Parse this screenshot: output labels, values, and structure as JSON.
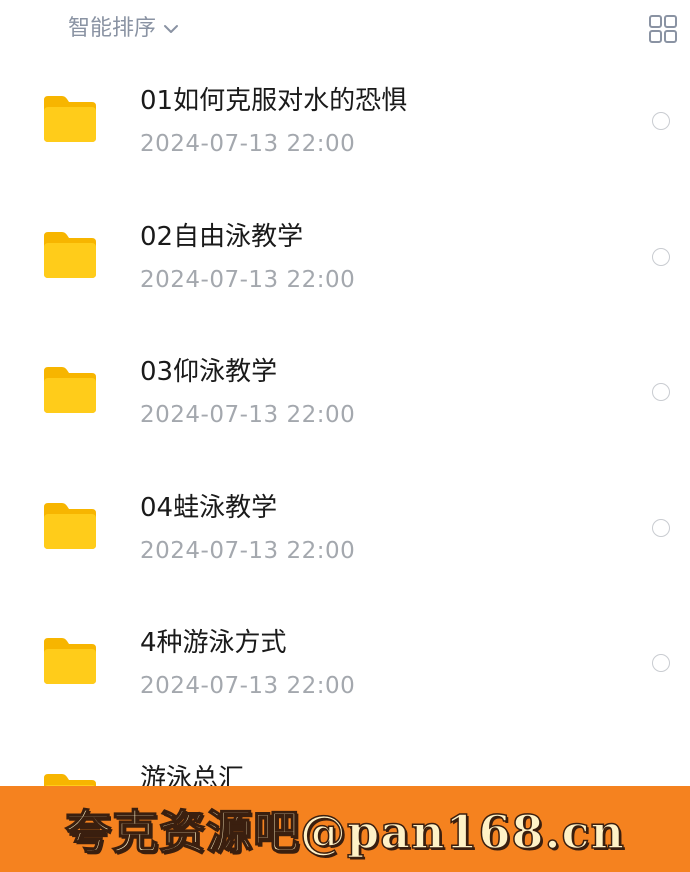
{
  "topbar": {
    "sort_label": "智能排序",
    "sort_icon": "chevron-down-icon",
    "view_toggle_icon": "grid-view-icon"
  },
  "files": [
    {
      "name": "01如何克服对水的恐惧",
      "date": "2024-07-13  22:00",
      "icon": "folder-icon"
    },
    {
      "name": "02自由泳教学",
      "date": "2024-07-13  22:00",
      "icon": "folder-icon"
    },
    {
      "name": "03仰泳教学",
      "date": "2024-07-13  22:00",
      "icon": "folder-icon"
    },
    {
      "name": "04蛙泳教学",
      "date": "2024-07-13  22:00",
      "icon": "folder-icon"
    },
    {
      "name": "4种游泳方式",
      "date": "2024-07-13  22:00",
      "icon": "folder-icon"
    },
    {
      "name": "游泳总汇",
      "date": "",
      "icon": "folder-icon"
    }
  ],
  "watermark": {
    "text": "夸克资源吧@pan168.cn"
  },
  "colors": {
    "folder": "#ffcc1a",
    "banner": "#f5821f",
    "muted_text": "#a4a8ae"
  }
}
